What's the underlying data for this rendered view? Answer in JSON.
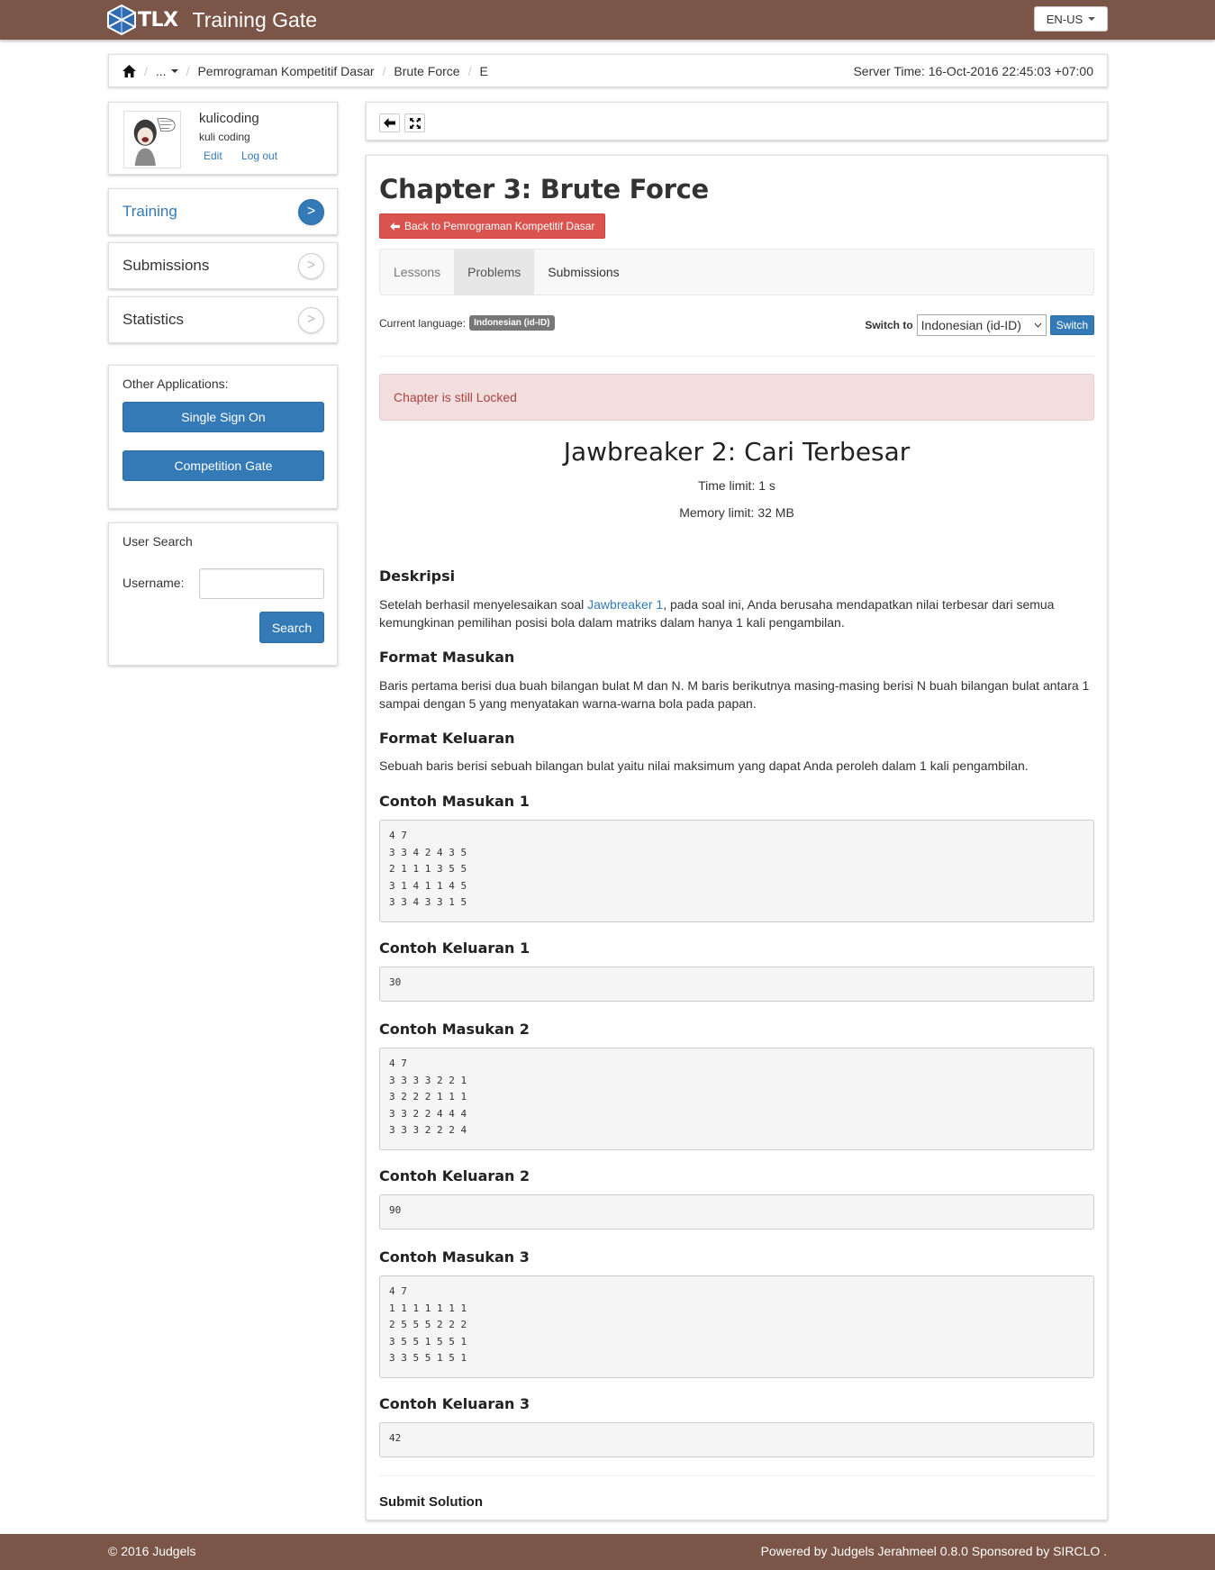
{
  "header": {
    "brand_short": "TLX",
    "brand_title": "Training Gate",
    "language_button": "EN-US"
  },
  "breadcrumb": {
    "home_icon": "home-icon",
    "ellipsis": "...",
    "items": [
      "Pemrograman Kompetitif Dasar",
      "Brute Force",
      "E"
    ],
    "server_time": "Server Time: 16-Oct-2016 22:45:03 +07:00"
  },
  "profile": {
    "username": "kulicoding",
    "realname": "kuli coding",
    "edit_label": "Edit",
    "logout_label": "Log out"
  },
  "sidebar": {
    "items": [
      {
        "label": "Training",
        "active": true,
        "arrow": ">"
      },
      {
        "label": "Submissions",
        "active": false,
        "arrow": ">"
      },
      {
        "label": "Statistics",
        "active": false,
        "arrow": ">"
      }
    ]
  },
  "other_apps": {
    "title": "Other Applications:",
    "buttons": [
      "Single Sign On",
      "Competition Gate"
    ]
  },
  "user_search": {
    "title": "User Search",
    "label": "Username:",
    "value": "",
    "button": "Search"
  },
  "toolbar": {
    "back_icon": "arrow-left-icon",
    "fullscreen_icon": "fullscreen-icon"
  },
  "chapter": {
    "title": "Chapter 3: Brute Force",
    "back_button": "Back to Pemrograman Kompetitif Dasar",
    "tabs": [
      "Lessons",
      "Problems",
      "Submissions"
    ],
    "active_tab": "Problems",
    "current_language_label": "Current language:",
    "current_language_badge": "Indonesian (id-ID)",
    "switch_label": "Switch to",
    "switch_select_value": "Indonesian (id-ID)",
    "switch_button": "Switch",
    "alert": "Chapter is still Locked"
  },
  "problem": {
    "title": "Jawbreaker 2: Cari Terbesar",
    "time_limit": "Time limit: 1 s",
    "memory_limit": "Memory limit: 32 MB",
    "desc_heading": "Deskripsi",
    "desc_before": "Setelah berhasil menyelesaikan soal ",
    "desc_link": "Jawbreaker 1",
    "desc_after": ", pada soal ini, Anda berusaha mendapatkan nilai terbesar dari semua kemungkinan pemilihan posisi bola dalam matriks dalam hanya 1 kali pengambilan.",
    "input_heading": "Format Masukan",
    "input_text": "Baris pertama berisi dua buah bilangan bulat M dan N. M baris berikutnya masing-masing berisi N buah bilangan bulat antara 1 sampai dengan 5 yang menyatakan warna-warna bola pada papan.",
    "output_heading": "Format Keluaran",
    "output_text": "Sebuah baris berisi sebuah bilangan bulat yaitu nilai maksimum yang dapat Anda peroleh dalam 1 kali pengambilan.",
    "samples": [
      {
        "in_heading": "Contoh Masukan 1",
        "input": "4 7\n3 3 4 2 4 3 5\n2 1 1 1 3 5 5\n3 1 4 1 1 4 5\n3 3 4 3 3 1 5",
        "out_heading": "Contoh Keluaran 1",
        "output": "30"
      },
      {
        "in_heading": "Contoh Masukan 2",
        "input": "4 7\n3 3 3 3 2 2 1\n3 2 2 2 1 1 1\n3 3 2 2 4 4 4\n3 3 3 2 2 2 4",
        "out_heading": "Contoh Keluaran 2",
        "output": "90"
      },
      {
        "in_heading": "Contoh Masukan 3",
        "input": "4 7\n1 1 1 1 1 1 1\n2 5 5 5 2 2 2\n3 5 5 1 5 5 1\n3 3 5 5 1 5 1",
        "out_heading": "Contoh Keluaran 3",
        "output": "42"
      }
    ],
    "submit_heading": "Submit Solution"
  },
  "footer": {
    "left": "© 2016 Judgels",
    "right": "Powered by Judgels Jerahmeel 0.8.0 Sponsored by SIRCLO ."
  },
  "colors": {
    "brand_brown": "#7b5547",
    "primary_blue": "#337ab7",
    "danger_red": "#d9534f",
    "alert_bg": "#f2dede"
  }
}
